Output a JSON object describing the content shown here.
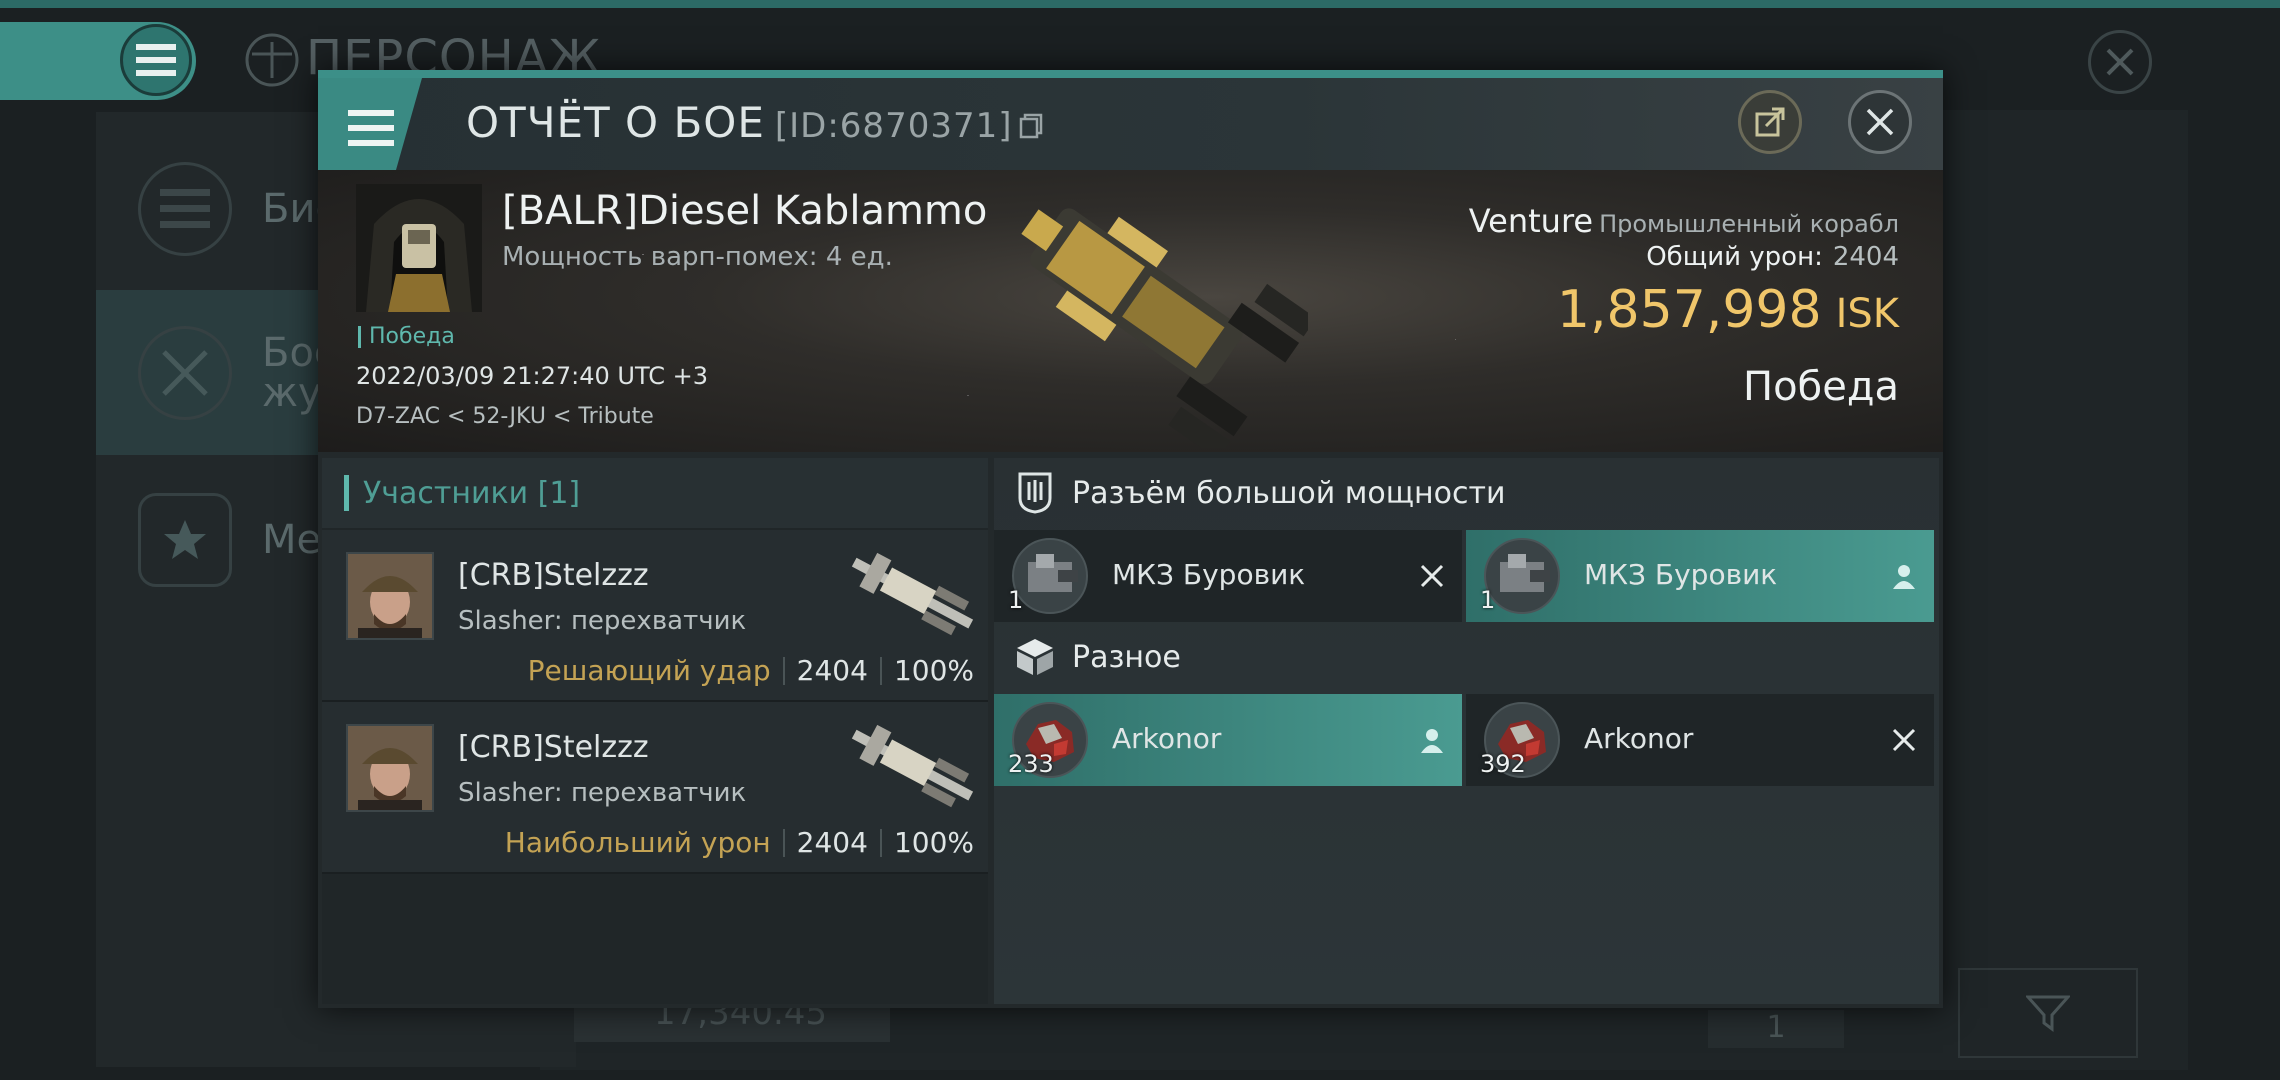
{
  "background": {
    "title": "ПЕРСОНАЖ",
    "sidebar": [
      {
        "label": "Био",
        "icon": "list-icon"
      },
      {
        "label": "Бое\nжур",
        "icon": "crossed-swords-icon"
      },
      {
        "label": "Мед",
        "icon": "star-medal-icon"
      }
    ],
    "bottom_value": "17,340.45",
    "page_number": "1"
  },
  "modal": {
    "title": "ОТЧЁТ О БОЕ",
    "report_id": "[ID:6870371]",
    "victim": {
      "name": "[BALR]Diesel Kablammo",
      "warp_disruption": "Мощность варп-помех: 4 ед.",
      "status_tag": "Победа",
      "datetime": "2022/03/09 21:27:40 UTC +3",
      "route": "D7-ZAC < 52-JKU < Tribute"
    },
    "ship": {
      "name": "Venture",
      "class": "Промышленный корабл",
      "total_damage_label": "Общий урон:",
      "total_damage": "2404",
      "isk_value": "1,857,998",
      "isk_unit": "ISK",
      "result": "Победа"
    },
    "participants": {
      "header": "Участники [1]",
      "rows": [
        {
          "name": "[CRB]Stelzzz",
          "ship": "Slasher: перехватчик",
          "tag": "Решающий удар",
          "damage": "2404",
          "percent": "100%"
        },
        {
          "name": "[CRB]Stelzzz",
          "ship": "Slasher: перехватчик",
          "tag": "Наибольший урон",
          "damage": "2404",
          "percent": "100%"
        }
      ]
    },
    "sections": [
      {
        "title": "Разъём большой мощности",
        "icon": "high-slot-icon",
        "items": [
          {
            "name": "МКЗ Буровик",
            "qty": "1",
            "state": "destroyed"
          },
          {
            "name": "МКЗ Буровик",
            "qty": "1",
            "state": "dropped"
          }
        ]
      },
      {
        "title": "Разное",
        "icon": "cube-icon",
        "items": [
          {
            "name": "Arkonor",
            "qty": "233",
            "state": "dropped"
          },
          {
            "name": "Arkonor",
            "qty": "392",
            "state": "destroyed"
          }
        ]
      }
    ]
  },
  "colors": {
    "accent": "#3c8f88",
    "isk": "#f0c66a",
    "tag_gold": "#c4a354"
  }
}
